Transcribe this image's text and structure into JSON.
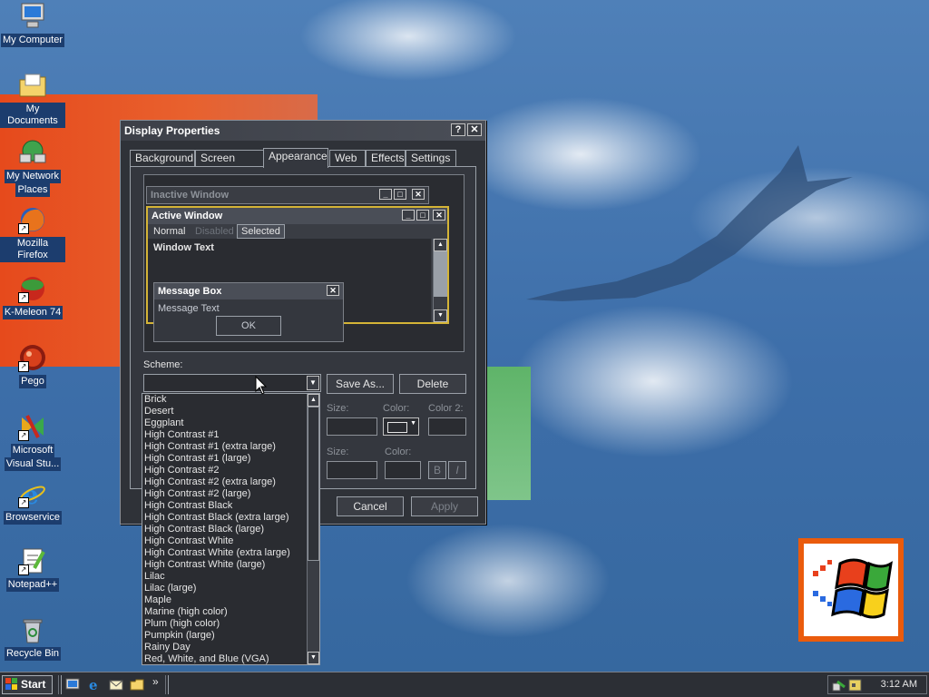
{
  "desktop": {
    "icons": [
      {
        "label_line1": "My Computer",
        "label_line2": ""
      },
      {
        "label_line1": "My Documents",
        "label_line2": ""
      },
      {
        "label_line1": "My Network",
        "label_line2": "Places"
      },
      {
        "label_line1": "Mozilla Firefox",
        "label_line2": ""
      },
      {
        "label_line1": "K-Meleon 74",
        "label_line2": ""
      },
      {
        "label_line1": "Pego",
        "label_line2": ""
      },
      {
        "label_line1": "Microsoft",
        "label_line2": "Visual Stu..."
      },
      {
        "label_line1": "Browservice",
        "label_line2": ""
      },
      {
        "label_line1": "Notepad++",
        "label_line2": ""
      },
      {
        "label_line1": "Recycle Bin",
        "label_line2": ""
      }
    ]
  },
  "dialog": {
    "title": "Display Properties",
    "help_glyph": "?",
    "close_glyph": "✕",
    "tabs": [
      "Background",
      "Screen Saver",
      "Appearance",
      "Web",
      "Effects",
      "Settings"
    ],
    "active_tab": "Appearance",
    "preview": {
      "inactive_title": "Inactive Window",
      "active_title": "Active Window",
      "menu_normal": "Normal",
      "menu_disabled": "Disabled",
      "menu_selected": "Selected",
      "window_text": "Window Text",
      "msgbox_title": "Message Box",
      "msgbox_text": "Message Text",
      "ok_label": "OK"
    },
    "scheme_label": "Scheme:",
    "scheme_value": "",
    "save_as_label": "Save As...",
    "delete_label": "Delete",
    "size_label": "Size:",
    "color_label": "Color:",
    "color2_label": "Color 2:",
    "size_label_2": "Size:",
    "color_label_2": "Color:",
    "bold_label": "B",
    "italic_label": "I",
    "cancel_label": "Cancel",
    "apply_label": "Apply"
  },
  "scheme_list": [
    "Brick",
    "Desert",
    "Eggplant",
    "High Contrast #1",
    "High Contrast #1 (extra large)",
    "High Contrast #1 (large)",
    "High Contrast #2",
    "High Contrast #2 (extra large)",
    "High Contrast #2 (large)",
    "High Contrast Black",
    "High Contrast Black (extra large)",
    "High Contrast Black (large)",
    "High Contrast White",
    "High Contrast White (extra large)",
    "High Contrast White (large)",
    "Lilac",
    "Lilac (large)",
    "Maple",
    "Marine (high color)",
    "Plum (high color)",
    "Pumpkin (large)",
    "Rainy Day",
    "Red, White, and Blue (VGA)"
  ],
  "taskbar": {
    "start_label": "Start",
    "chevron": "»",
    "clock": "3:12 AM"
  },
  "colors": {
    "dialog_bg": "#2f3238",
    "active_border": "#d4b437",
    "selected_bg": "#4a4e57",
    "text": "#e6e6e6"
  }
}
